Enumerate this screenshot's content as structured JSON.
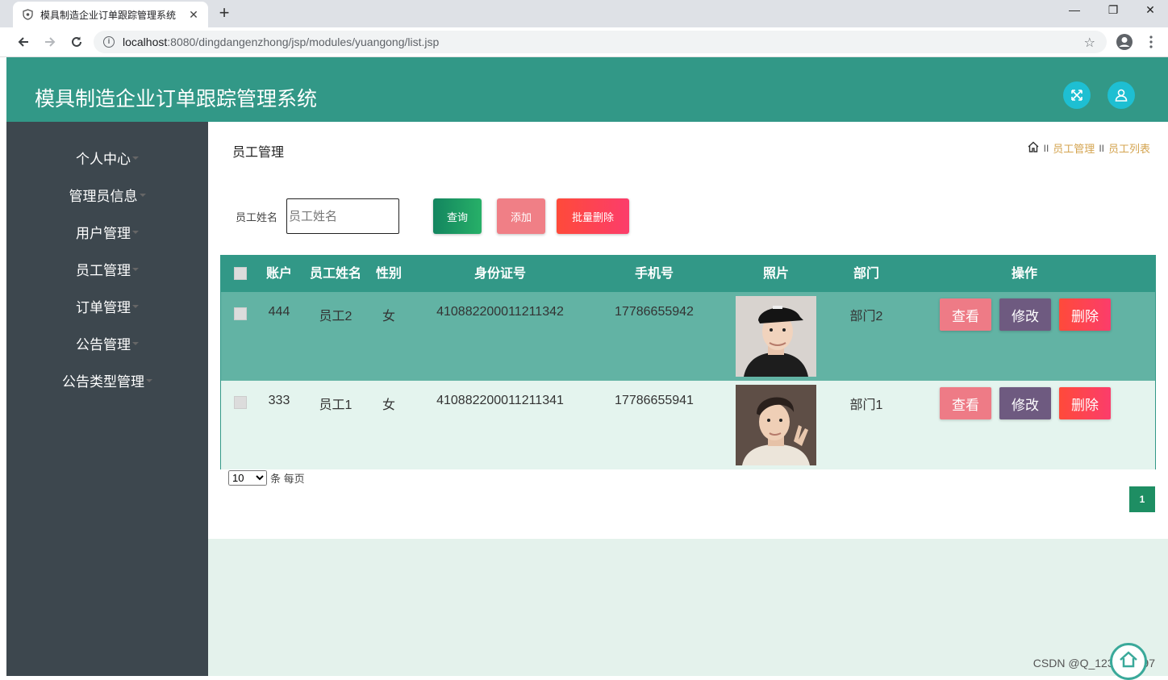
{
  "browser": {
    "tab_title": "模具制造企业订单跟踪管理系统",
    "url_host": "localhost",
    "url_path": ":8080/dingdangenzhong/jsp/modules/yuangong/list.jsp"
  },
  "header": {
    "title": "模具制造企业订单跟踪管理系统"
  },
  "sidebar": {
    "items": [
      {
        "label": "个人中心"
      },
      {
        "label": "管理员信息"
      },
      {
        "label": "用户管理"
      },
      {
        "label": "员工管理"
      },
      {
        "label": "订单管理"
      },
      {
        "label": "公告管理"
      },
      {
        "label": "公告类型管理"
      }
    ]
  },
  "page": {
    "heading": "员工管理",
    "breadcrumb": [
      "员工管理",
      "员工列表"
    ],
    "breadcrumb_sep": "II"
  },
  "search": {
    "label": "员工姓名",
    "placeholder": "员工姓名",
    "query_label": "查询",
    "add_label": "添加",
    "batch_delete_label": "批量删除"
  },
  "table": {
    "headers": [
      "账户",
      "员工姓名",
      "性别",
      "身份证号",
      "手机号",
      "照片",
      "部门",
      "操作"
    ],
    "rows": [
      {
        "account": "444",
        "name": "员工2",
        "gender": "女",
        "id_number": "410882200011211342",
        "phone": "17786655942",
        "department": "部门2"
      },
      {
        "account": "333",
        "name": "员工1",
        "gender": "女",
        "id_number": "410882200011211341",
        "phone": "17786655941",
        "department": "部门1"
      }
    ],
    "view_label": "查看",
    "edit_label": "修改",
    "delete_label": "删除"
  },
  "pagination": {
    "page_size": "10",
    "page_size_suffix": "条 每页",
    "current_page": "1"
  },
  "watermark": "CSDN @Q_1233111197",
  "colors": {
    "header": "#329887",
    "sidebar": "#3d474e",
    "row_selected": "#62b3a4",
    "row_normal": "#e4f4ee",
    "view_btn": "#ee7b86",
    "edit_btn": "#6e5a80",
    "delete_btn": "#fe4543"
  }
}
